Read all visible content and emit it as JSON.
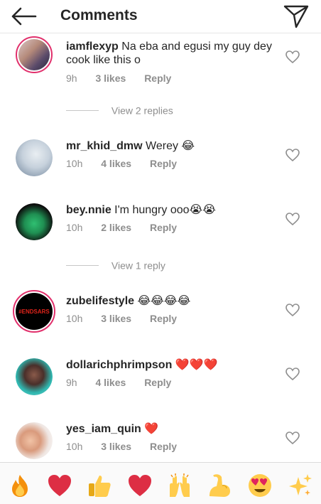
{
  "header": {
    "title": "Comments"
  },
  "comments": [
    {
      "username": "iamflexyp",
      "text": "Na eba and egusi my guy dey cook like this o",
      "time": "9h",
      "likes": "3 likes",
      "reply": "Reply"
    },
    {
      "username": "mr_khid_dmw",
      "text": "Werey 😂",
      "time": "10h",
      "likes": "4 likes",
      "reply": "Reply"
    },
    {
      "username": "bey.nnie",
      "text": "I'm hungry ooo😭😭",
      "time": "10h",
      "likes": "2 likes",
      "reply": "Reply"
    },
    {
      "username": "zubelifestyle",
      "text": "😂😂😂😂",
      "time": "10h",
      "likes": "3 likes",
      "reply": "Reply",
      "avatar_text": "#ENDSARS"
    },
    {
      "username": "dollarichphrimpson",
      "text": "❤️❤️❤️",
      "time": "9h",
      "likes": "4 likes",
      "reply": "Reply"
    },
    {
      "username": "yes_iam_quin",
      "text": "❤️",
      "time": "10h",
      "likes": "3 likes",
      "reply": "Reply"
    }
  ],
  "view_replies": [
    "View 2 replies",
    "View 1 reply"
  ],
  "emoji_bar": [
    "🔥",
    "❤️",
    "👍",
    "❤️",
    "🙌",
    "💪",
    "😍",
    "✨"
  ]
}
